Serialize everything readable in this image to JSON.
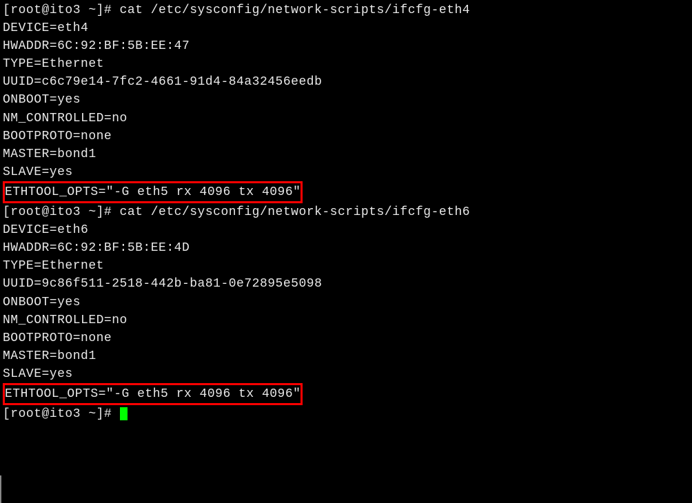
{
  "block1": {
    "prompt_cmd": "[root@ito3 ~]# cat /etc/sysconfig/network-scripts/ifcfg-eth4",
    "device": "DEVICE=eth4",
    "hwaddr": "HWADDR=6C:92:BF:5B:EE:47",
    "type": "TYPE=Ethernet",
    "uuid": "UUID=c6c79e14-7fc2-4661-91d4-84a32456eedb",
    "onboot": "ONBOOT=yes",
    "nm_controlled": "NM_CONTROLLED=no",
    "bootproto": "BOOTPROTO=none",
    "master": "MASTER=bond1",
    "slave": "SLAVE=yes",
    "ethtool_opts": "ETHTOOL_OPTS=\"-G eth5 rx 4096 tx 4096\"",
    "after_highlight1": "                "
  },
  "block2": {
    "prompt_cmd": "[root@ito3 ~]# cat /etc/sysconfig/network-scripts/ifcfg-eth6",
    "device": "DEVICE=eth6",
    "hwaddr": "HWADDR=6C:92:BF:5B:EE:4D",
    "type": "TYPE=Ethernet",
    "uuid": "UUID=9c86f511-2518-442b-ba81-0e72895e5098",
    "onboot": "ONBOOT=yes",
    "nm_controlled": "NM_CONTROLLED=no",
    "bootproto": "BOOTPROTO=none",
    "master": "MASTER=bond1",
    "slave": "SLAVE=yes",
    "ethtool_opts": "ETHTOOL_OPTS=\"-G eth5 rx 4096 tx 4096\"",
    "after_highlight2": "                "
  },
  "final_prompt": "[root@ito3 ~]# "
}
